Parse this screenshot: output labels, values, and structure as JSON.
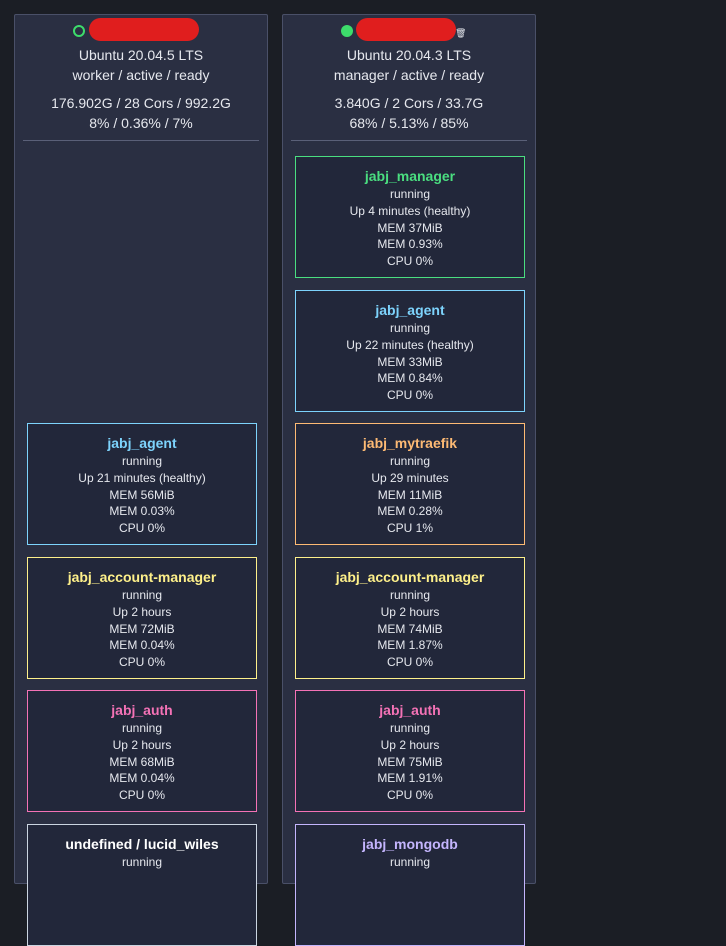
{
  "nodes": [
    {
      "status": "down",
      "os": "Ubuntu 20.04.5 LTS",
      "role_line": "worker / active / ready",
      "resources": "176.902G / 28 Cors / 992.2G",
      "usage": "8% / 0.36% / 7%",
      "services": [
        {
          "name": "jabj_agent",
          "state": "running",
          "uptime": "Up 21 minutes (healthy)",
          "mem": "MEM 56MiB",
          "mem_pct": "MEM 0.03%",
          "cpu": "CPU 0%",
          "color": "#7dd3fc"
        },
        {
          "name": "jabj_account-manager",
          "state": "running",
          "uptime": "Up 2 hours",
          "mem": "MEM 72MiB",
          "mem_pct": "MEM 0.04%",
          "cpu": "CPU 0%",
          "color": "#fef08a"
        },
        {
          "name": "jabj_auth",
          "state": "running",
          "uptime": "Up 2 hours",
          "mem": "MEM 68MiB",
          "mem_pct": "MEM 0.04%",
          "cpu": "CPU 0%",
          "color": "#f472b6"
        },
        {
          "name": "undefined / lucid_wiles",
          "state": "running",
          "color": "#ffffff"
        }
      ]
    },
    {
      "status": "up",
      "os": "Ubuntu 20.04.3 LTS",
      "role_line": "manager / active / ready",
      "resources": "3.840G / 2 Cors / 33.7G",
      "usage": "68% / 5.13% / 85%",
      "trash_icon": "trash-icon",
      "services": [
        {
          "name": "jabj_manager",
          "state": "running",
          "uptime": "Up 4 minutes (healthy)",
          "mem": "MEM 37MiB",
          "mem_pct": "MEM 0.93%",
          "cpu": "CPU 0%",
          "color": "#4ade80"
        },
        {
          "name": "jabj_agent",
          "state": "running",
          "uptime": "Up 22 minutes (healthy)",
          "mem": "MEM 33MiB",
          "mem_pct": "MEM 0.84%",
          "cpu": "CPU 0%",
          "color": "#7dd3fc"
        },
        {
          "name": "jabj_mytraefik",
          "state": "running",
          "uptime": "Up 29 minutes",
          "mem": "MEM 11MiB",
          "mem_pct": "MEM 0.28%",
          "cpu": "CPU 1%",
          "color": "#fdba74"
        },
        {
          "name": "jabj_account-manager",
          "state": "running",
          "uptime": "Up 2 hours",
          "mem": "MEM 74MiB",
          "mem_pct": "MEM 1.87%",
          "cpu": "CPU 0%",
          "color": "#fef08a"
        },
        {
          "name": "jabj_auth",
          "state": "running",
          "uptime": "Up 2 hours",
          "mem": "MEM 75MiB",
          "mem_pct": "MEM 1.91%",
          "cpu": "CPU 0%",
          "color": "#f472b6"
        },
        {
          "name": "jabj_mongodb",
          "state": "running",
          "color": "#c4b5fd"
        }
      ]
    }
  ]
}
